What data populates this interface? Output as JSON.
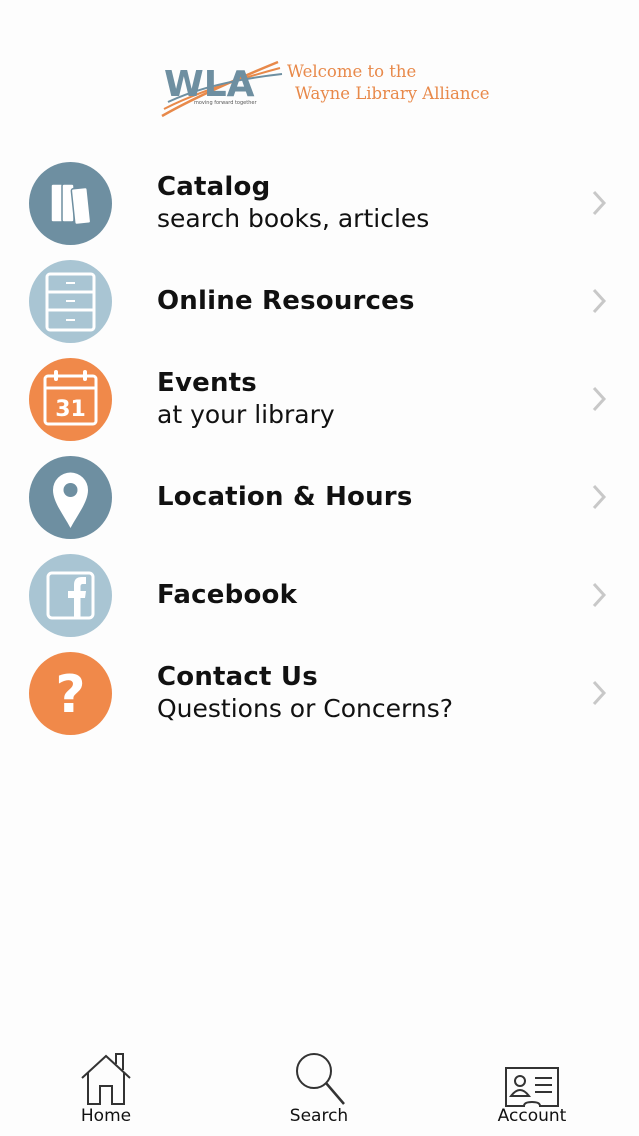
{
  "header": {
    "logo_text": "WLA",
    "logo_tagline": "moving forward together",
    "welcome_line1": "Welcome to the",
    "welcome_line2": "Wayne Library Alliance"
  },
  "colors": {
    "slate": "#6e8fa1",
    "light_blue": "#a9c5d3",
    "orange": "#f0894a",
    "chevron": "#c8c8c8"
  },
  "menu": [
    {
      "title": "Catalog",
      "subtitle": "search books, articles",
      "icon": "books-icon"
    },
    {
      "title": "Online Resources",
      "subtitle": "",
      "icon": "file-cabinet-icon"
    },
    {
      "title": "Events",
      "subtitle": "at your library",
      "icon": "calendar-icon",
      "icon_text": "31"
    },
    {
      "title": "Location & Hours",
      "subtitle": "",
      "icon": "map-pin-icon"
    },
    {
      "title": "Facebook",
      "subtitle": "",
      "icon": "facebook-icon"
    },
    {
      "title": "Contact Us",
      "subtitle": "Questions or Concerns?",
      "icon": "question-icon",
      "icon_text": "?"
    }
  ],
  "tabbar": {
    "home_label": "Home",
    "search_label": "Search",
    "account_label": "Account"
  }
}
